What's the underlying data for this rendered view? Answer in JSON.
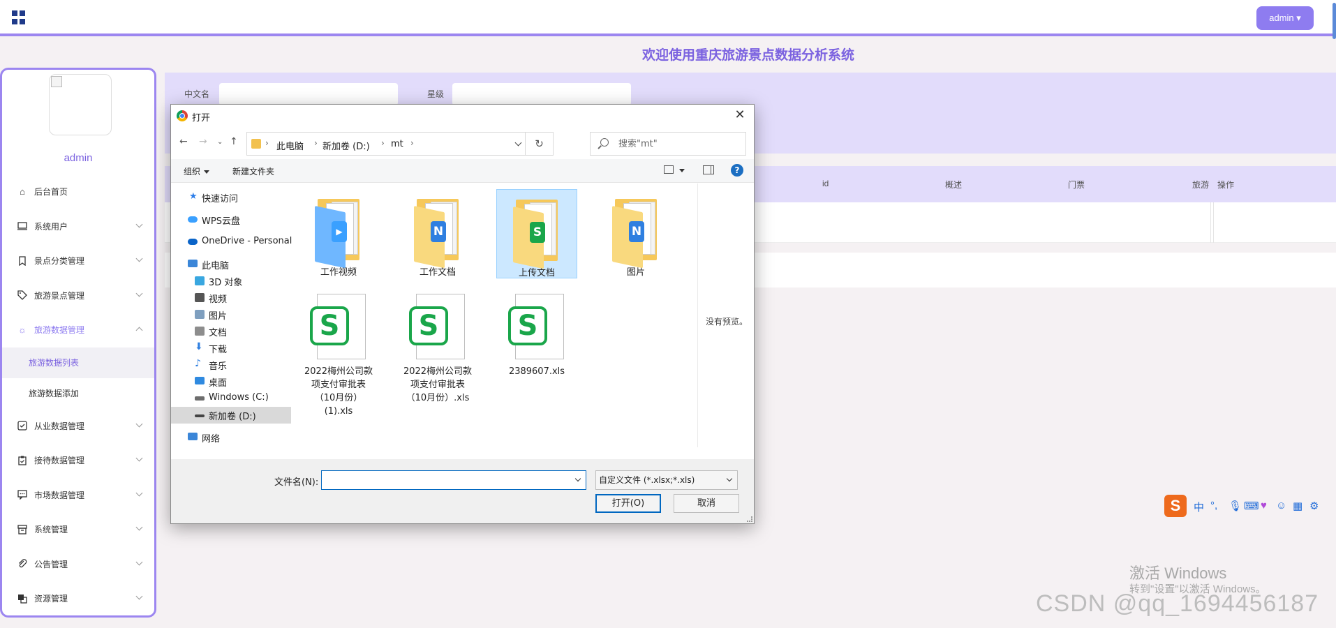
{
  "topbar": {
    "admin_label": "admin ▾"
  },
  "page_title": "欢迎使用重庆旅游景点数据分析系统",
  "sidebar": {
    "username": "admin",
    "items": [
      {
        "label": "后台首页",
        "icon": "home-icon"
      },
      {
        "label": "系统用户",
        "icon": "monitor-icon"
      },
      {
        "label": "景点分类管理",
        "icon": "bookmark-icon"
      },
      {
        "label": "旅游景点管理",
        "icon": "tag-icon"
      },
      {
        "label": "旅游数据管理",
        "icon": "sun-icon"
      },
      {
        "label": "旅游数据列表"
      },
      {
        "label": "旅游数据添加"
      },
      {
        "label": "从业数据管理",
        "icon": "checkbox-icon"
      },
      {
        "label": "接待数据管理",
        "icon": "clipboard-icon"
      },
      {
        "label": "市场数据管理",
        "icon": "comment-icon"
      },
      {
        "label": "系统管理",
        "icon": "archive-icon"
      },
      {
        "label": "公告管理",
        "icon": "paperclip-icon"
      },
      {
        "label": "资源管理",
        "icon": "copy-icon"
      }
    ]
  },
  "search": {
    "label_name": "中文名",
    "label_level": "星级"
  },
  "table": {
    "headers": [
      "id",
      "概述",
      "门票",
      "旅游",
      "操作"
    ]
  },
  "dialog": {
    "title": "打开",
    "path": [
      "此电脑",
      "新加卷 (D:)",
      "mt"
    ],
    "search_placeholder": "搜索\"mt\"",
    "toolbar": {
      "organize": "组织",
      "new_folder": "新建文件夹"
    },
    "nav": [
      {
        "label": "快速访问",
        "color": "#2b7de9"
      },
      {
        "label": "WPS云盘",
        "color": "#3aa0ff"
      },
      {
        "label": "OneDrive - Personal",
        "color": "#0a64c8"
      },
      {
        "label": "此电脑",
        "color": "#3b86d8"
      },
      {
        "label": "3D 对象",
        "color": "#39a7e0"
      },
      {
        "label": "视频",
        "color": "#555"
      },
      {
        "label": "图片",
        "color": "#7f9fbf"
      },
      {
        "label": "文档",
        "color": "#8d8d8d"
      },
      {
        "label": "下载",
        "color": "#2f7fe0"
      },
      {
        "label": "音乐",
        "color": "#2f7fe0"
      },
      {
        "label": "桌面",
        "color": "#2f8ae0"
      },
      {
        "label": "Windows (C:)",
        "color": "#6d6d6d"
      },
      {
        "label": "新加卷 (D:)",
        "color": "#444"
      },
      {
        "label": "网络",
        "color": "#3b86d8"
      }
    ],
    "files": [
      {
        "name": "工作视频",
        "type": "folder",
        "badge": "▶",
        "badge_color": "#3aa0ff"
      },
      {
        "name": "工作文档",
        "type": "folder",
        "badge": "N",
        "badge_color": "#2f7fe0"
      },
      {
        "name": "上传文档",
        "type": "folder",
        "badge": "S",
        "badge_color": "#1aa64a"
      },
      {
        "name": "图片",
        "type": "folder",
        "badge": "N",
        "badge_color": "#2f7fe0"
      },
      {
        "name": "2022梅州公司款项支付审批表（10月份）(1).xls",
        "type": "xls"
      },
      {
        "name": "2022梅州公司款项支付审批表（10月份）.xls",
        "type": "xls"
      },
      {
        "name": "2389607.xls",
        "type": "xls"
      }
    ],
    "no_preview": "没有预览。",
    "filename_label": "文件名(N):",
    "filename_value": "",
    "filter": "自定义文件 (*.xlsx;*.xls)",
    "open_label": "打开(O)",
    "cancel_label": "取消"
  },
  "ime": {
    "s": "S",
    "mode": "中",
    "punct": "°,"
  },
  "watermark": {
    "activate_title": "激活 Windows",
    "activate_hint": "转到\"设置\"以激活 Windows。",
    "csdn": "CSDN @qq_1694456187"
  }
}
